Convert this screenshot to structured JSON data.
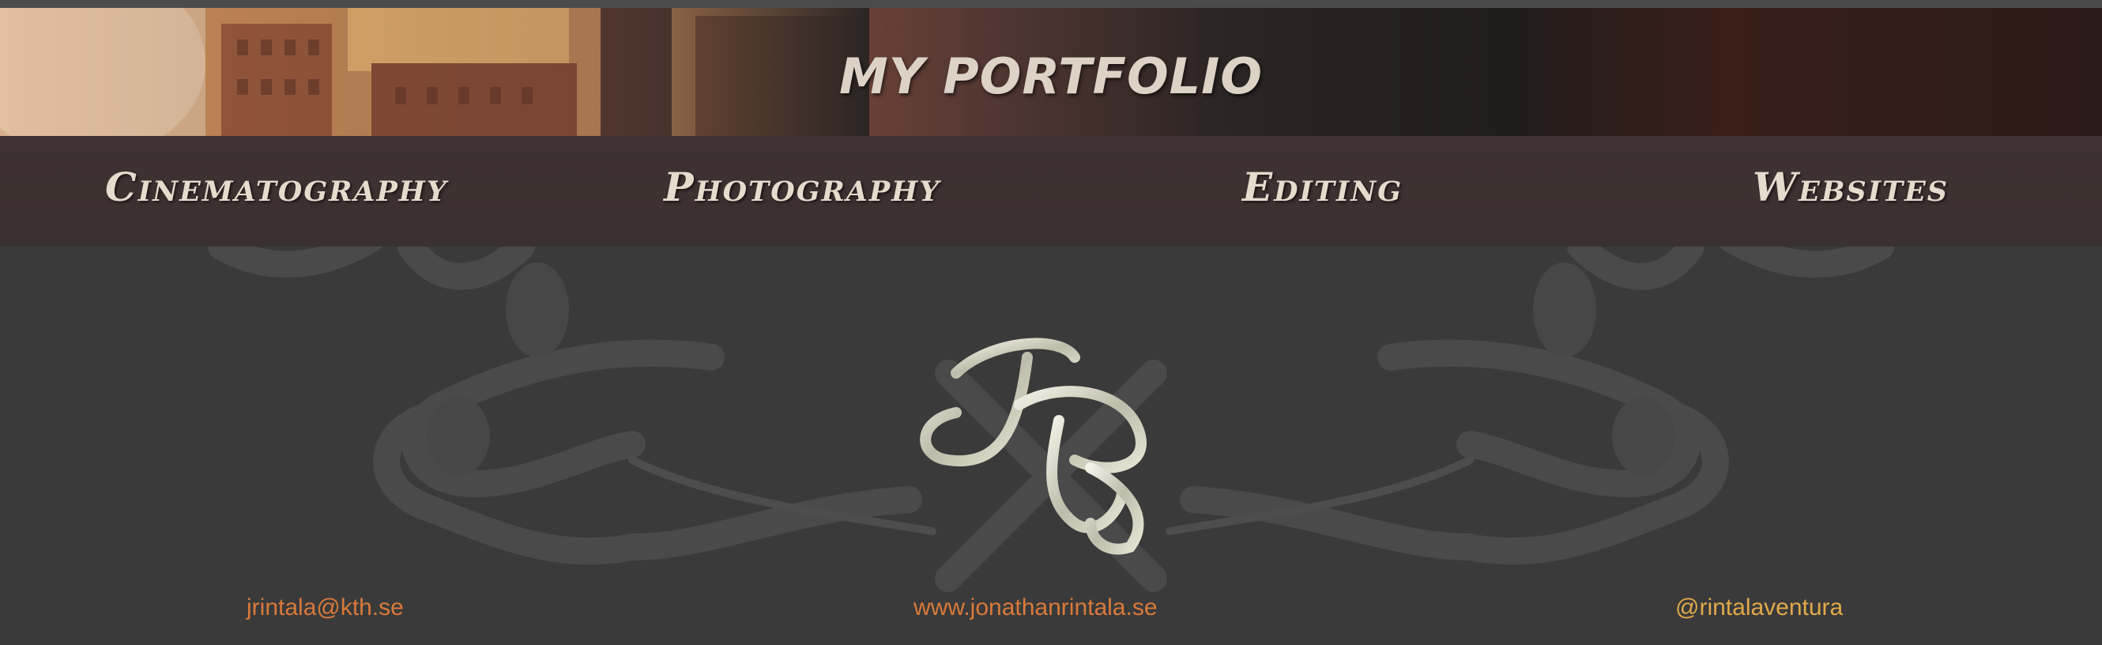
{
  "header": {
    "title": "MY PORTFOLIO"
  },
  "nav": {
    "items": [
      {
        "label": "Cinematography"
      },
      {
        "label": "Photography"
      },
      {
        "label": "Editing"
      },
      {
        "label": "Websites"
      }
    ]
  },
  "logo": {
    "monogram": "JR"
  },
  "footer_links": {
    "email": "jrintala@kth.se",
    "website": "www.jonathanrintala.se",
    "social": "@rintalaventura"
  },
  "colors": {
    "link_orange": "#d97a3a",
    "link_gold": "#e1a94a",
    "nav_text": "#e4dccd",
    "background": "#3a3a3a"
  }
}
